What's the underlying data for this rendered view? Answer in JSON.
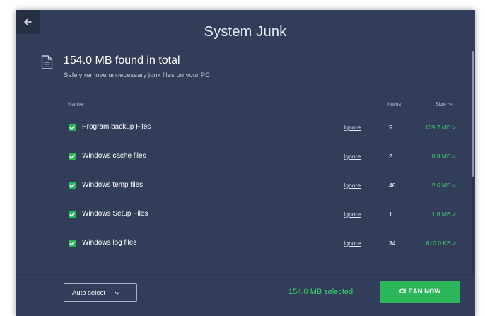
{
  "header": {
    "title": "System Junk"
  },
  "summary": {
    "title": "154.0 MB found in total",
    "subtitle": "Safely remove unnecessary junk files on your PC."
  },
  "table": {
    "col_name": "Name",
    "col_items": "Items",
    "col_size": "Size",
    "rows": [
      {
        "name": "Program backup Files",
        "ignore": "Ignore",
        "items": "5",
        "size": "139.7 MB >",
        "checked": true
      },
      {
        "name": "Windows cache files",
        "ignore": "Ignore",
        "items": "2",
        "size": "8.8 MB >",
        "checked": true
      },
      {
        "name": "Windows temp files",
        "ignore": "Ignore",
        "items": "48",
        "size": "2.6 MB >",
        "checked": true
      },
      {
        "name": "Windows Setup Files",
        "ignore": "Ignore",
        "items": "1",
        "size": "1.6 MB >",
        "checked": true
      },
      {
        "name": "Windows log files",
        "ignore": "Ignore",
        "items": "34",
        "size": "610.0 KB >",
        "checked": true
      }
    ]
  },
  "footer": {
    "auto_select": "Auto select",
    "selected": "154.0 MB selected",
    "clean_button": "CLEAN NOW"
  },
  "colors": {
    "background": "#323d59",
    "accent_green": "#2bb65a",
    "size_green": "#3bd46a"
  },
  "icons": [
    "back-arrow-icon",
    "document-icon",
    "chevron-down-icon",
    "checkmark-icon"
  ]
}
